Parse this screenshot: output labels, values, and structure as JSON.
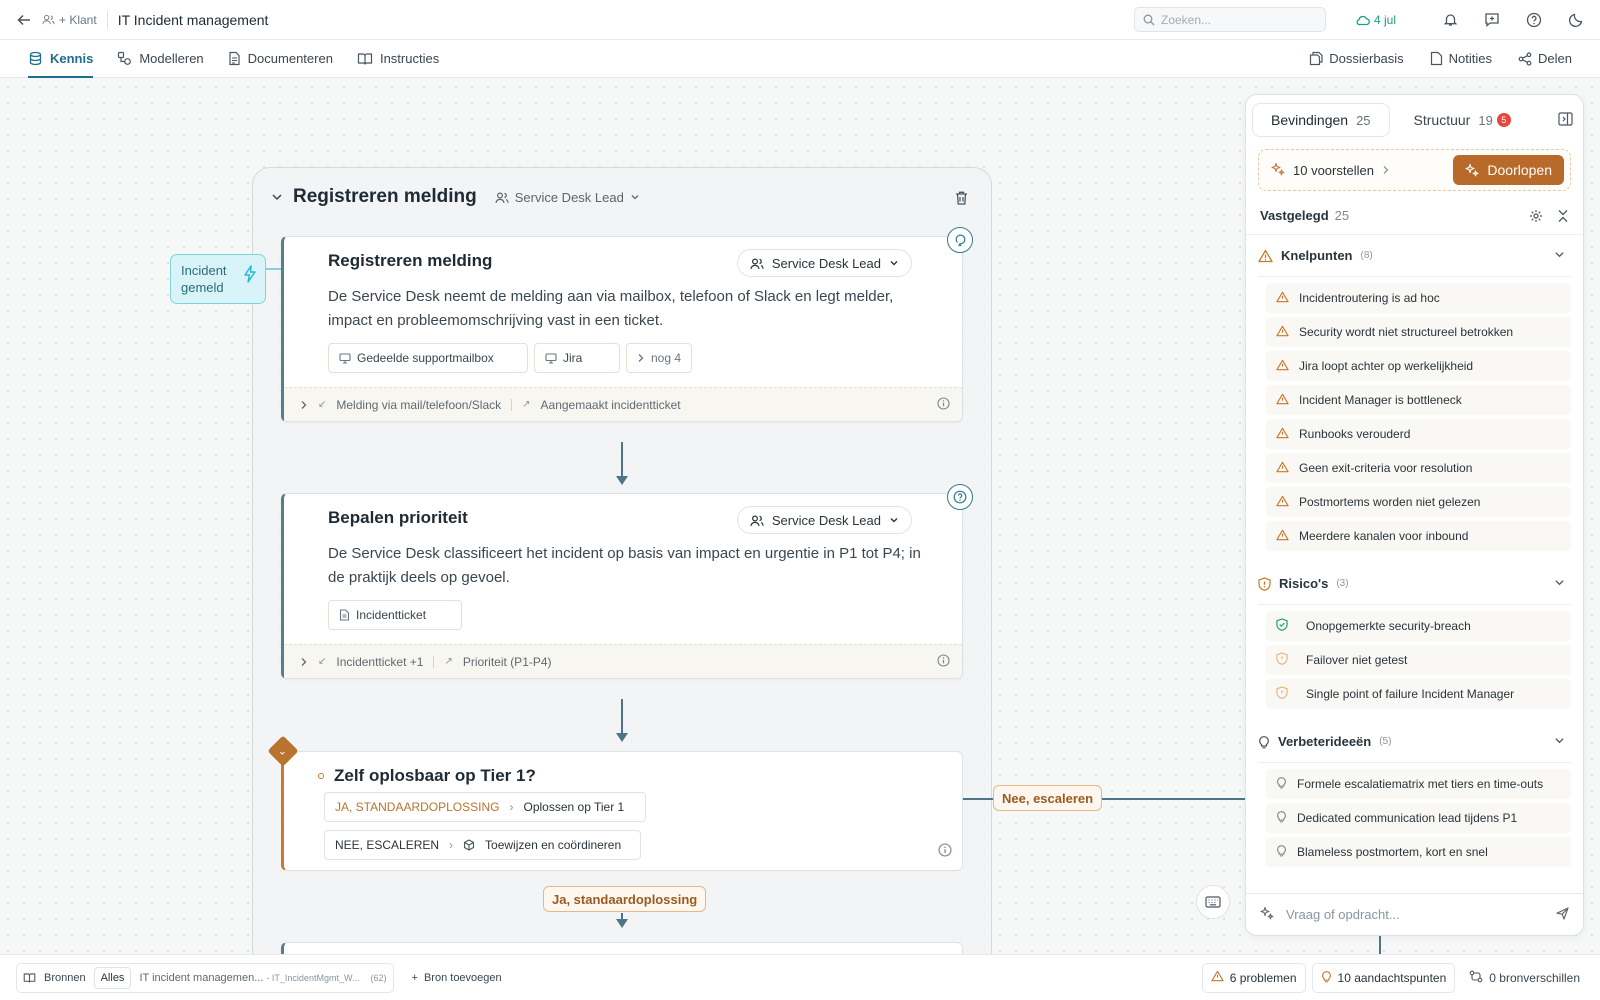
{
  "topbar": {
    "crumb_client": "+ Klant",
    "title": "IT Incident management",
    "search_placeholder": "Zoeken...",
    "date": "4 jul"
  },
  "tabs": [
    {
      "label": "Kennis"
    },
    {
      "label": "Modelleren"
    },
    {
      "label": "Documenteren"
    },
    {
      "label": "Instructies"
    }
  ],
  "tabs_right": [
    {
      "label": "Dossierbasis"
    },
    {
      "label": "Notities"
    },
    {
      "label": "Delen"
    }
  ],
  "lane": {
    "title": "Registreren melding",
    "role": "Service Desk Lead"
  },
  "event": {
    "label": "Incident gemeld"
  },
  "cards": [
    {
      "title": "Registreren melding",
      "role": "Service Desk Lead",
      "desc": "De Service Desk neemt de melding aan via mailbox, telefoon of Slack en legt melder, impact en probleemomschrijving vast in een ticket.",
      "chips": [
        "Gedeelde supportmailbox",
        "Jira",
        "nog 4"
      ],
      "input": "Melding via mail/telefoon/Slack",
      "output": "Aangemaakt incidentticket"
    },
    {
      "title": "Bepalen prioriteit",
      "role": "Service Desk Lead",
      "desc": "De Service Desk classificeert het incident op basis van impact en urgentie in P1 tot P4; in de praktijk deels op gevoel.",
      "chips": [
        "Incidentticket"
      ],
      "input": "Incidentticket +1",
      "output": "Prioriteit (P1-P4)"
    }
  ],
  "decision": {
    "title": "Zelf oplosbaar op Tier 1?",
    "branches": [
      {
        "tag": "JA, STANDAARDOPLOSSING",
        "target": "Oplossen op Tier 1"
      },
      {
        "tag": "NEE, ESCALEREN",
        "target": "Toewijzen en coördineren"
      }
    ],
    "label_no": "Nee, escaleren",
    "label_yes": "Ja, standaardoplossing"
  },
  "panel": {
    "tab_findings": "Bevindingen",
    "tab_findings_count": "25",
    "tab_structure": "Structuur",
    "tab_structure_count": "19",
    "tab_structure_badge": "5",
    "proposals": "10 voorstellen",
    "review_button": "Doorlopen",
    "vastgelegd": "Vastgelegd",
    "vastgelegd_count": "25",
    "sections": [
      {
        "title": "Knelpunten",
        "count": "(8)",
        "items": [
          "Incidentroutering is ad hoc",
          "Security wordt niet structureel betrokken",
          "Jira loopt achter op werkelijkheid",
          "Incident Manager is bottleneck",
          "Runbooks verouderd",
          "Geen exit-criteria voor resolution",
          "Postmortems worden niet gelezen",
          "Meerdere kanalen voor inbound"
        ]
      },
      {
        "title": "Risico's",
        "count": "(3)",
        "items": [
          "Onopgemerkte security-breach",
          "Failover niet getest",
          "Single point of failure Incident Manager"
        ]
      },
      {
        "title": "Verbeterideeën",
        "count": "(5)",
        "items": [
          "Formele escalatiematrix met tiers en time-outs",
          "Dedicated communication lead tijdens P1",
          "Blameless postmortem, kort en snel"
        ]
      }
    ],
    "chat_placeholder": "Vraag of opdracht..."
  },
  "bottombar": {
    "sources": "Bronnen",
    "all": "Alles",
    "file": "IT incident managemen...",
    "file_sub": "- IT_IncidentMgmt_W...",
    "file_count": "(62)",
    "add_source": "Bron toevoegen",
    "problems": "6 problemen",
    "attention": "10 aandachtspunten",
    "differences": "0 bronverschillen"
  },
  "colors": {
    "accent": "#1d6f8c",
    "warning": "#c8782e",
    "primary_button": "#b86a2a",
    "event": "#d9f4f8"
  }
}
